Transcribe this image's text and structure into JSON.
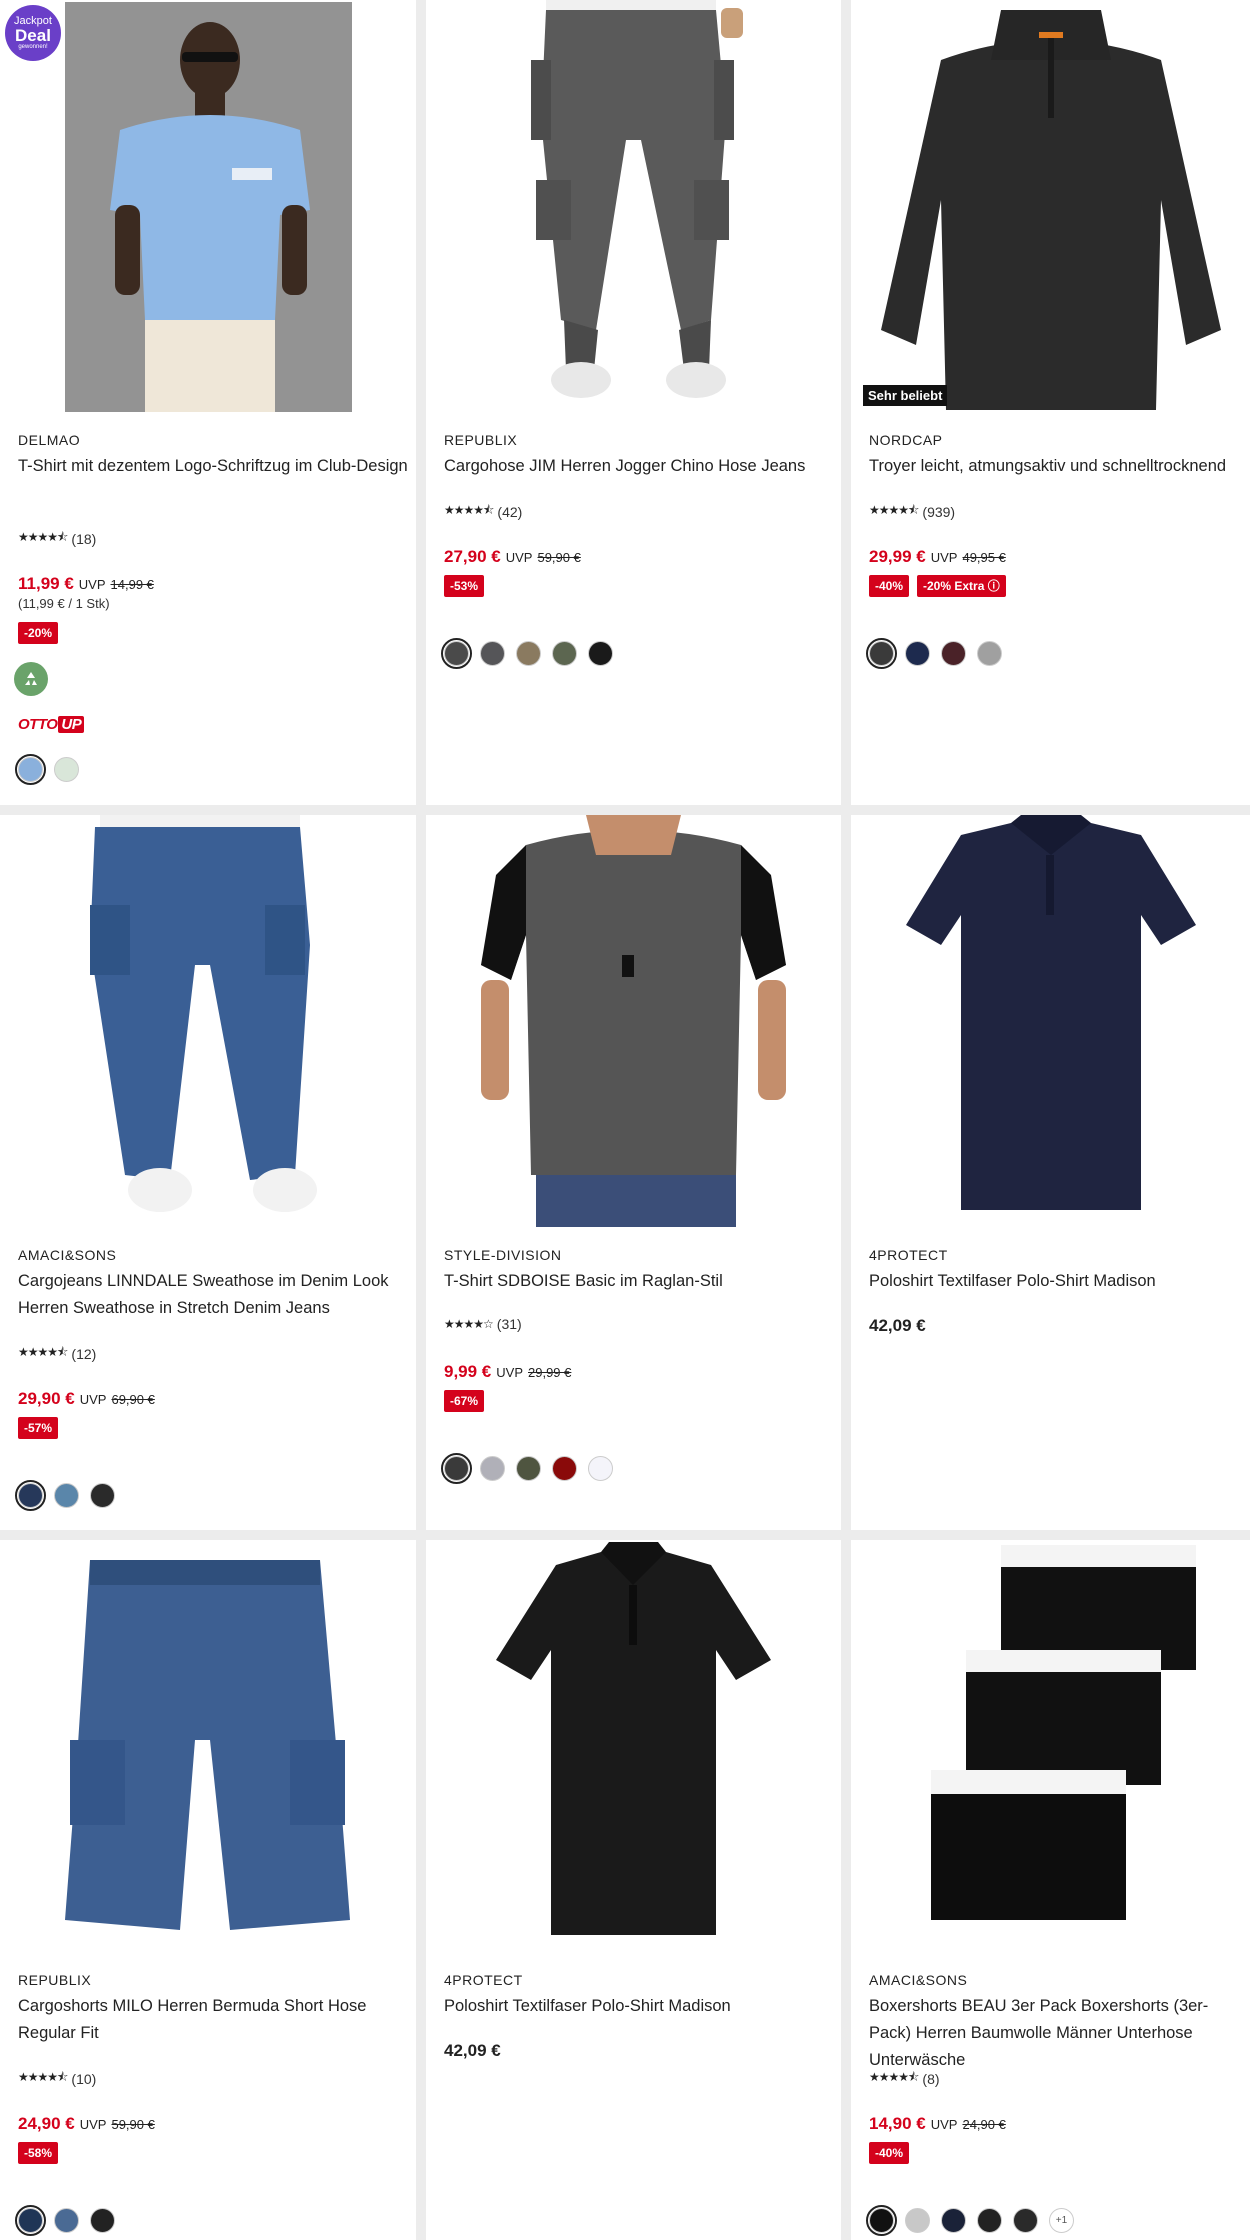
{
  "products": [
    {
      "brand": "DELMAO",
      "title": "T-Shirt mit dezentem Logo-Schriftzug im Club-Design",
      "stars": "★★★★⯪",
      "reviews": "(18)",
      "price": "11,99 €",
      "uvp_label": "UVP",
      "uvp": "14,99 €",
      "unit_price": "(11,99 € / 1 Stk)",
      "badges": [
        "-20%"
      ],
      "deal_badge": {
        "line1": "Jackpot",
        "line2": "Deal",
        "line3": "gewonnen!"
      },
      "eco_icon": "recycle-icon",
      "otto_up": {
        "otto": "OTTO",
        "up": "UP"
      },
      "swatches": [
        "#8ab0dc",
        "#d9e6d9"
      ]
    },
    {
      "brand": "REPUBLIX",
      "title": "Cargohose JIM Herren Jogger Chino Hose Jeans",
      "stars": "★★★★⯪",
      "reviews": "(42)",
      "price": "27,90 €",
      "uvp_label": "UVP",
      "uvp": "59,90 €",
      "badges": [
        "-53%"
      ],
      "swatches": [
        "#4a4a4a",
        "#555558",
        "#8a7a60",
        "#5c6650",
        "#1a1a1a"
      ]
    },
    {
      "brand": "NORDCAP",
      "title": "Troyer leicht, atmungsaktiv und schnelltrocknend",
      "stars": "★★★★⯪",
      "reviews": "(939)",
      "price": "29,99 €",
      "uvp_label": "UVP",
      "uvp": "49,95 €",
      "badges": [
        "-40%",
        "-20% Extra ⓘ"
      ],
      "tag": "Sehr beliebt",
      "swatches": [
        "#3a3a3a",
        "#1d2a4e",
        "#4a2228",
        "#a0a0a0"
      ]
    },
    {
      "brand": "AMACI&SONS",
      "title": "Cargojeans LINNDALE Sweathose im Denim Look Herren Sweathose in Stretch Denim Jeans",
      "stars": "★★★★⯪",
      "reviews": "(12)",
      "price": "29,90 €",
      "uvp_label": "UVP",
      "uvp": "69,90 €",
      "badges": [
        "-57%"
      ],
      "swatches": [
        "#26385a",
        "#5a86aa",
        "#2a2a2a"
      ]
    },
    {
      "brand": "STYLE-DIVISION",
      "title": "T-Shirt SDBOISE Basic im Raglan-Stil",
      "stars": "★★★★☆",
      "reviews": "(31)",
      "price": "9,99 €",
      "uvp_label": "UVP",
      "uvp": "29,99 €",
      "badges": [
        "-67%"
      ],
      "swatches": [
        "#3a3a3a",
        "#b0b0b8",
        "#4f5540",
        "#8a0a0a",
        "#f4f4fa"
      ]
    },
    {
      "brand": "4PROTECT",
      "title": "Poloshirt Textilfaser Polo-Shirt Madison",
      "price": "42,09 €"
    },
    {
      "brand": "REPUBLIX",
      "title": "Cargoshorts MILO Herren Bermuda Short Hose Regular Fit",
      "stars": "★★★★⯪",
      "reviews": "(10)",
      "price": "24,90 €",
      "uvp_label": "UVP",
      "uvp": "59,90 €",
      "badges": [
        "-58%"
      ],
      "swatches": [
        "#1f3556",
        "#4a6a94",
        "#222222"
      ]
    },
    {
      "brand": "4PROTECT",
      "title": "Poloshirt Textilfaser Polo-Shirt Madison",
      "price": "42,09 €"
    },
    {
      "brand": "AMACI&SONS",
      "title": "Boxershorts BEAU 3er Pack Boxershorts (3er-Pack) Herren Baumwolle Männer Unterhose Unterwäsche",
      "stars": "★★★★⯪",
      "reviews": "(8)",
      "price": "14,90 €",
      "uvp_label": "UVP",
      "uvp": "24,90 €",
      "badges": [
        "-40%"
      ],
      "swatches": [
        "#111111",
        "#c8c8c8",
        "#1a2238",
        "#222222",
        "#2a2a2a"
      ],
      "more_colors": "+1"
    }
  ]
}
